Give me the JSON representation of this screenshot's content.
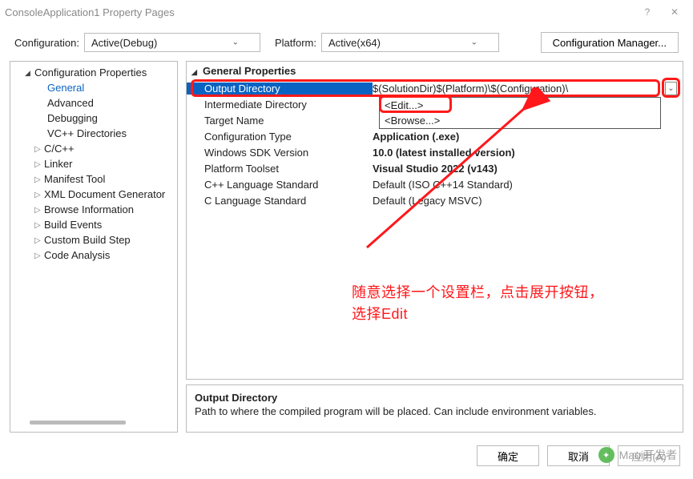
{
  "window": {
    "title": "ConsoleApplication1 Property Pages",
    "help_icon": "?",
    "close_icon": "✕"
  },
  "config_row": {
    "config_label": "Configuration:",
    "config_value": "Active(Debug)",
    "platform_label": "Platform:",
    "platform_value": "Active(x64)",
    "manager_button": "Configuration Manager..."
  },
  "nav": {
    "root": "Configuration Properties",
    "items": [
      {
        "label": "General",
        "selected": true
      },
      {
        "label": "Advanced"
      },
      {
        "label": "Debugging"
      },
      {
        "label": "VC++ Directories"
      },
      {
        "label": "C/C++",
        "expandable": true
      },
      {
        "label": "Linker",
        "expandable": true
      },
      {
        "label": "Manifest Tool",
        "expandable": true
      },
      {
        "label": "XML Document Generator",
        "expandable": true
      },
      {
        "label": "Browse Information",
        "expandable": true
      },
      {
        "label": "Build Events",
        "expandable": true
      },
      {
        "label": "Custom Build Step",
        "expandable": true
      },
      {
        "label": "Code Analysis",
        "expandable": true
      }
    ]
  },
  "props": {
    "section_title": "General Properties",
    "rows": [
      {
        "key": "Output Directory",
        "val": "$(SolutionDir)$(Platform)\\$(Configuration)\\",
        "selected": true,
        "bold": false
      },
      {
        "key": "Intermediate Directory",
        "val": "",
        "bold": false
      },
      {
        "key": "Target Name",
        "val": "",
        "bold": false
      },
      {
        "key": "Configuration Type",
        "val": "Application (.exe)",
        "bold": true
      },
      {
        "key": "Windows SDK Version",
        "val": "10.0 (latest installed version)",
        "bold": true
      },
      {
        "key": "Platform Toolset",
        "val": "Visual Studio 2022 (v143)",
        "bold": true
      },
      {
        "key": "C++ Language Standard",
        "val": "Default (ISO C++14 Standard)",
        "bold": false
      },
      {
        "key": "C Language Standard",
        "val": "Default (Legacy MSVC)",
        "bold": false
      }
    ],
    "dropdown": {
      "option1": "<Edit...>",
      "option2": "<Browse...>"
    }
  },
  "annotation": {
    "line1": "随意选择一个设置栏，点击展开按钮，",
    "line2": "选择Edit"
  },
  "desc": {
    "title": "Output Directory",
    "text": "Path to where the compiled program will be placed. Can include environment variables."
  },
  "footer": {
    "ok": "确定",
    "cancel": "取消",
    "apply": "应用(A)"
  },
  "watermark": {
    "text": "Maui开发者"
  }
}
